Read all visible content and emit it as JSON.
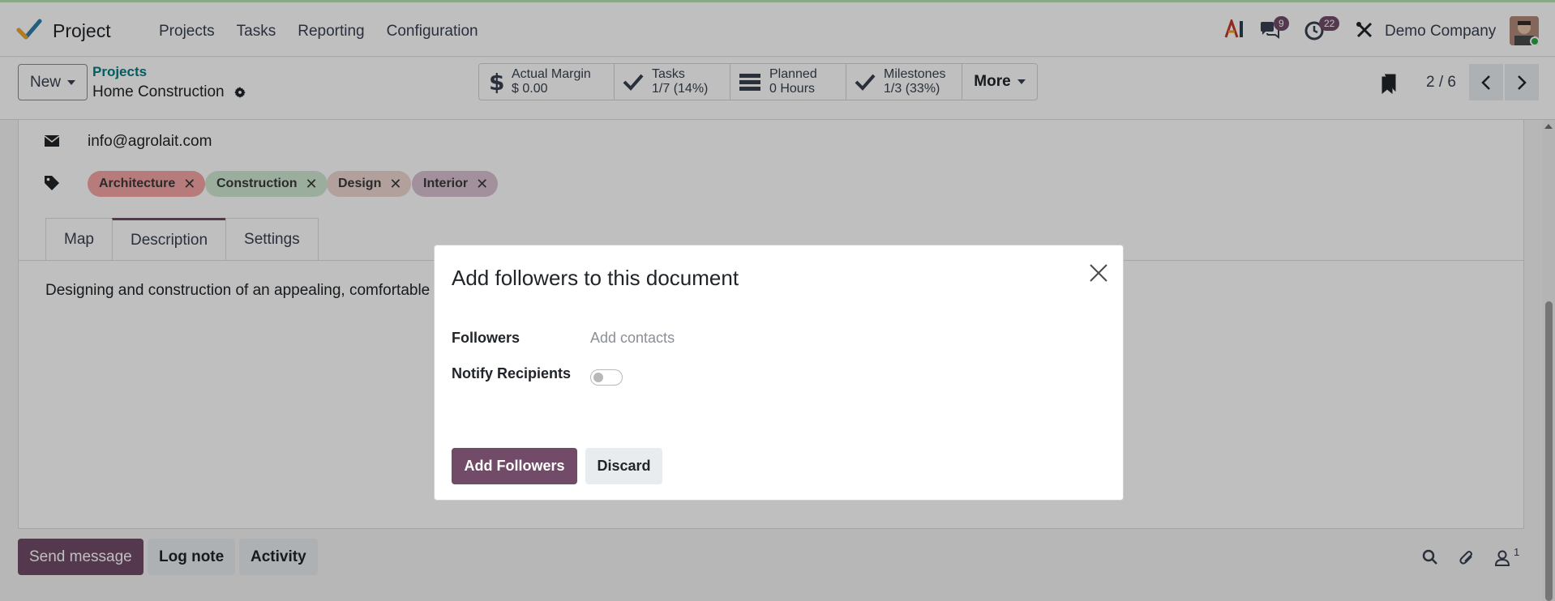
{
  "navbar": {
    "app_name": "Project",
    "menu": [
      "Projects",
      "Tasks",
      "Reporting",
      "Configuration"
    ],
    "messages_count": "9",
    "activities_count": "22",
    "company": "Demo Company"
  },
  "control_panel": {
    "new_label": "New",
    "breadcrumb_parent": "Projects",
    "breadcrumb_current": "Home Construction",
    "stats": [
      {
        "title": "Actual Margin",
        "value": "$ 0.00",
        "icon": "dollar-icon"
      },
      {
        "title": "Tasks",
        "value": "1/7 (14%)",
        "icon": "check-icon"
      },
      {
        "title": "Planned",
        "value": "0 Hours",
        "icon": "tasks-icon"
      },
      {
        "title": "Milestones",
        "value": "1/3 (33%)",
        "icon": "check-icon"
      }
    ],
    "more_label": "More",
    "pager": "2 / 6"
  },
  "form": {
    "email": "info@agrolait.com",
    "tags": [
      {
        "label": "Architecture",
        "color": "#f4a4a4"
      },
      {
        "label": "Construction",
        "color": "#cfe8d3"
      },
      {
        "label": "Design",
        "color": "#ecd6d1"
      },
      {
        "label": "Interior",
        "color": "#d9c2d2"
      }
    ],
    "tabs": [
      "Map",
      "Description",
      "Settings"
    ],
    "active_tab": "Description",
    "description": "Designing and construction of an appealing, comfortable"
  },
  "chatter": {
    "send_message": "Send message",
    "log_note": "Log note",
    "activity": "Activity",
    "followers_count": "1"
  },
  "modal": {
    "title": "Add followers to this document",
    "followers_label": "Followers",
    "followers_placeholder": "Add contacts",
    "notify_label": "Notify Recipients",
    "notify_enabled": false,
    "primary_button": "Add Followers",
    "secondary_button": "Discard"
  },
  "colors": {
    "brand": "#714b67",
    "link": "#017e84"
  }
}
